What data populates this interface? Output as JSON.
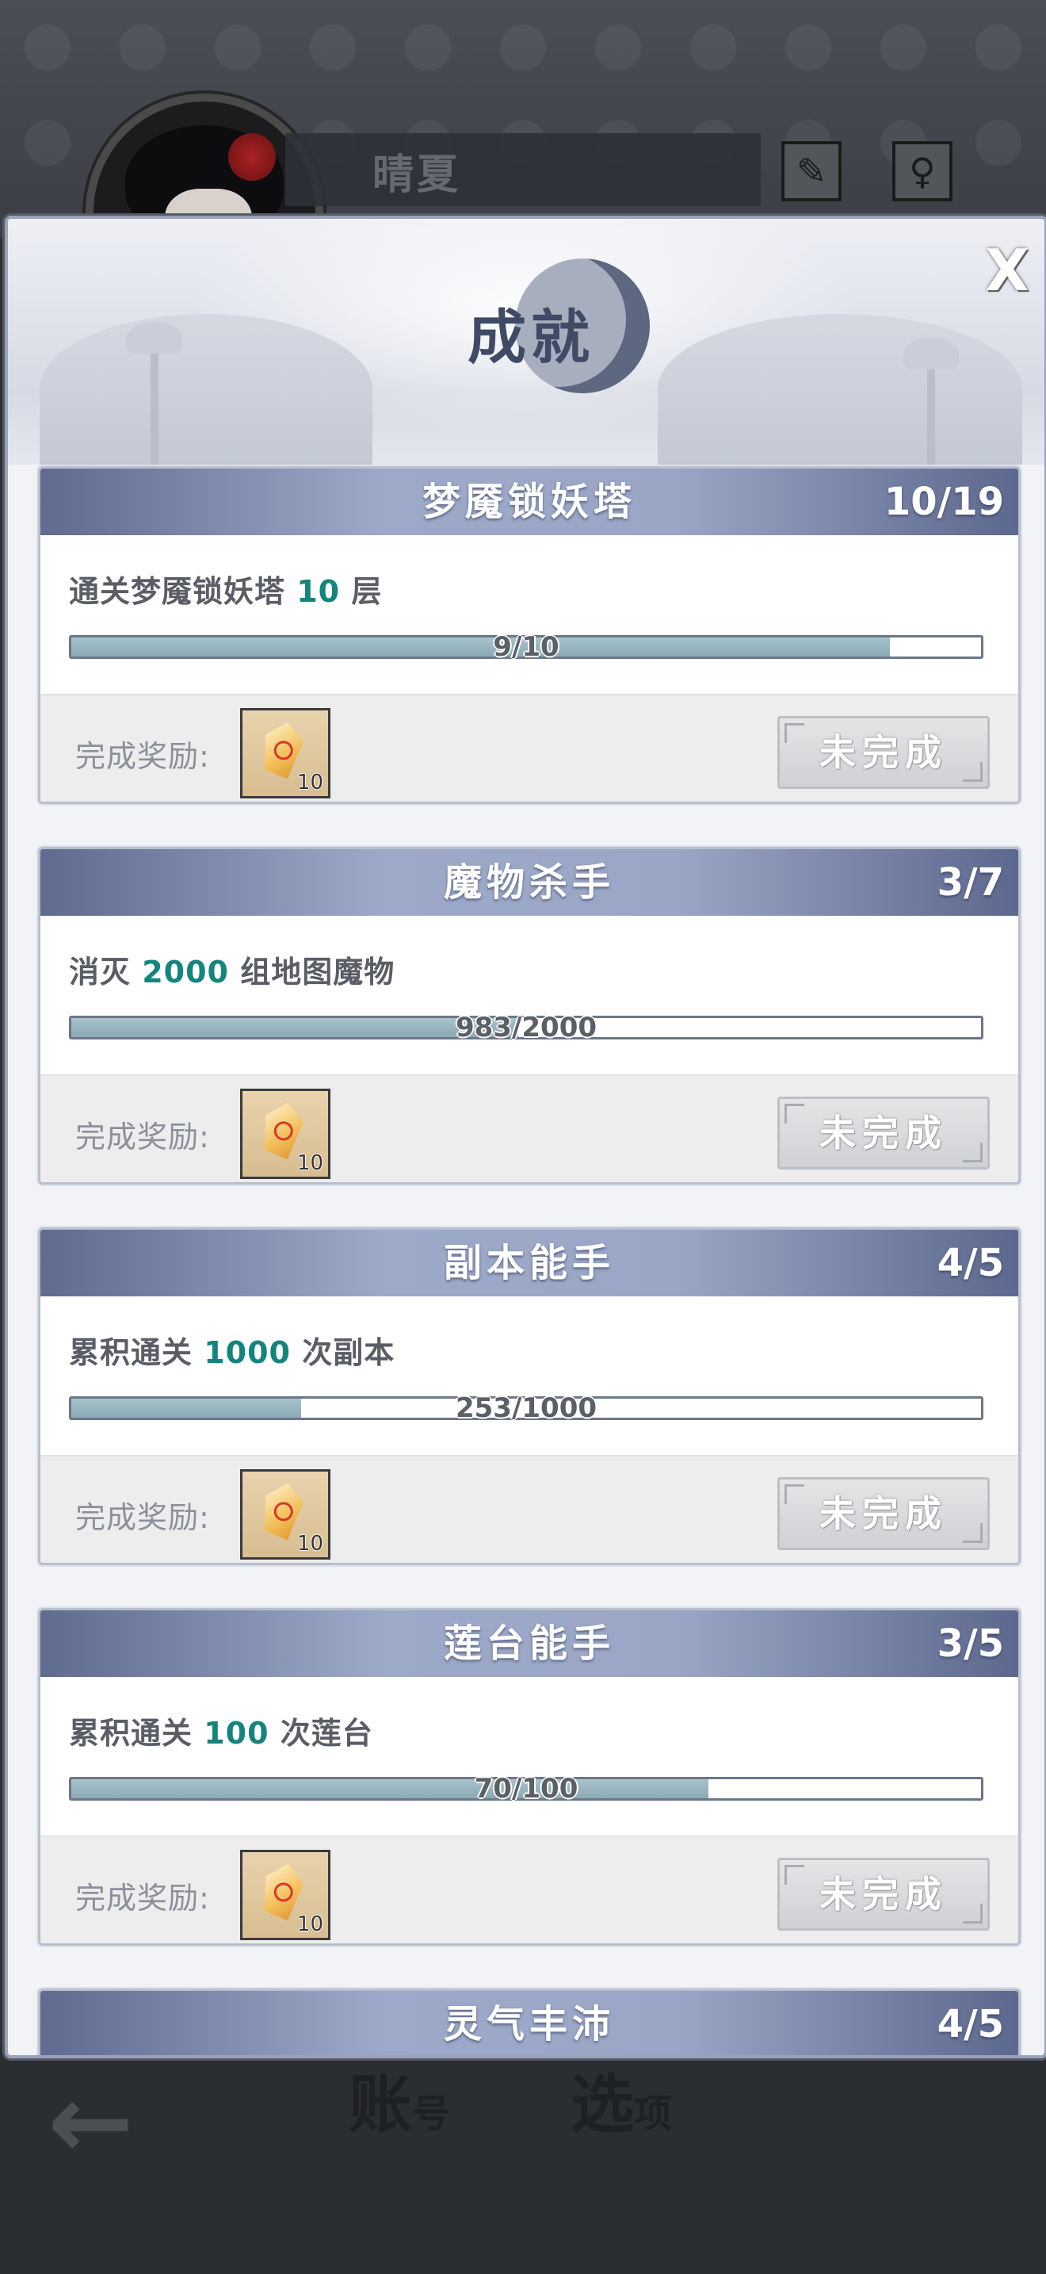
{
  "header": {
    "player_name": "晴夏",
    "brush_icon": "brush-icon",
    "gender_icon": "female-symbol-icon"
  },
  "modal": {
    "title": "成就",
    "close_label": "X"
  },
  "achievements": [
    {
      "title": "梦魇锁妖塔",
      "count": "10/19",
      "desc_prefix": "通关梦魇锁妖塔 ",
      "desc_num": "10",
      "desc_suffix": " 层",
      "progress_text": "9/10",
      "progress_fraction": 0.9,
      "reward_label": "完成奖励:",
      "reward_qty": "10",
      "status": "未完成"
    },
    {
      "title": "魔物杀手",
      "count": "3/7",
      "desc_prefix": "消灭 ",
      "desc_num": "2000",
      "desc_suffix": " 组地图魔物",
      "progress_text": "983/2000",
      "progress_fraction": 0.4915,
      "reward_label": "完成奖励:",
      "reward_qty": "10",
      "status": "未完成"
    },
    {
      "title": "副本能手",
      "count": "4/5",
      "desc_prefix": "累积通关 ",
      "desc_num": "1000",
      "desc_suffix": " 次副本",
      "progress_text": "253/1000",
      "progress_fraction": 0.253,
      "reward_label": "完成奖励:",
      "reward_qty": "10",
      "status": "未完成"
    },
    {
      "title": "莲台能手",
      "count": "3/5",
      "desc_prefix": "累积通关 ",
      "desc_num": "100",
      "desc_suffix": " 次莲台",
      "progress_text": "70/100",
      "progress_fraction": 0.7,
      "reward_label": "完成奖励:",
      "reward_qty": "10",
      "status": "未完成"
    },
    {
      "title": "灵气丰沛",
      "count": "4/5"
    }
  ],
  "bottom_nav": {
    "back_icon": "back-arrow-icon",
    "tab_account_main": "账",
    "tab_account_sub": "号",
    "tab_options_main": "选",
    "tab_options_sub": "项"
  }
}
